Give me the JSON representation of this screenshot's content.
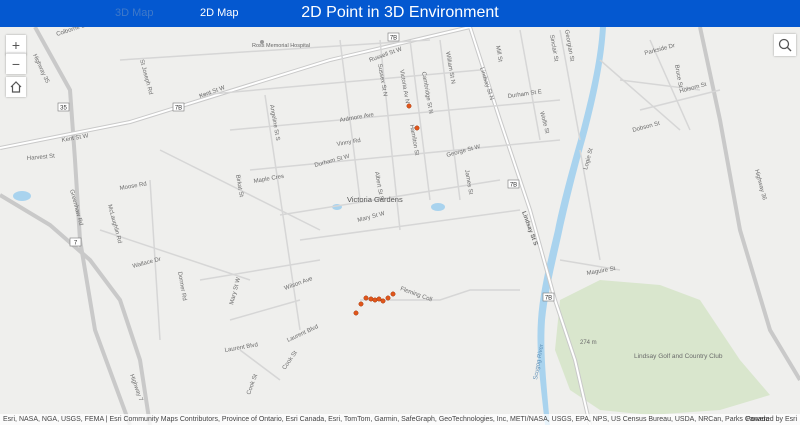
{
  "header": {
    "tabs": [
      {
        "label": "3D Map"
      },
      {
        "label": "2D Map"
      }
    ],
    "title": "2D Point in 3D Environment"
  },
  "controls": {
    "zoom_in": "+",
    "zoom_out": "−",
    "home_icon": "home-icon",
    "search_icon": "search-icon"
  },
  "map": {
    "streets": [
      "Colborne St W",
      "St Joseph Rd",
      "Highway 35",
      "Kent St W",
      "Kent St W",
      "Harvest St",
      "Ross Memorial Hospital",
      "Russell St W",
      "Sussex St N",
      "Victoria Av N",
      "Cambridge St N",
      "William St N",
      "Lindsay St N",
      "Mill St",
      "Sinclair St",
      "Georgian St",
      "Parkside Dr",
      "Bruce St",
      "Durham St E",
      "Wolfe St",
      "Dobson St",
      "Ardmore Ave",
      "Angeline St S",
      "Vinny Rd",
      "Durham St W",
      "George St W",
      "Hamilton St",
      "James St",
      "Moose Rd",
      "Maple Cres",
      "Birkat St",
      "Greenhaw Rd",
      "McLaughlin Rd",
      "Victoria Gardens",
      "Albert St S",
      "Mary St W",
      "Wallace Dr",
      "Dormer Rd",
      "Wilson Ave",
      "Mary St W",
      "Laurent Blvd",
      "Laurent Blvd",
      "Cook St",
      "Cook St",
      "Highway 7",
      "Lindsay St S",
      "Fleming Coll",
      "Scugog River",
      "Maguire St",
      "Lindsay Golf and Country Club",
      "274 m",
      "Highway 36",
      "Holsom St",
      "Logie St"
    ],
    "shields": [
      "35",
      "7B",
      "7B",
      "7B",
      "7B",
      "7"
    ],
    "points_color": "#e0561b",
    "water_color": "#a9d3ee",
    "park_color": "#d9e6cd"
  },
  "attribution": {
    "text": "Esri, NASA, NGA, USGS, FEMA | Esri Community Maps Contributors, Province of Ontario, Esri Canada, Esri, TomTom, Garmin, SafeGraph, GeoTechnologies, Inc, METI/NASA, USGS, EPA, NPS, US Census Bureau, USDA, NRCan, Parks Canada",
    "powered": "Powered by Esri"
  }
}
